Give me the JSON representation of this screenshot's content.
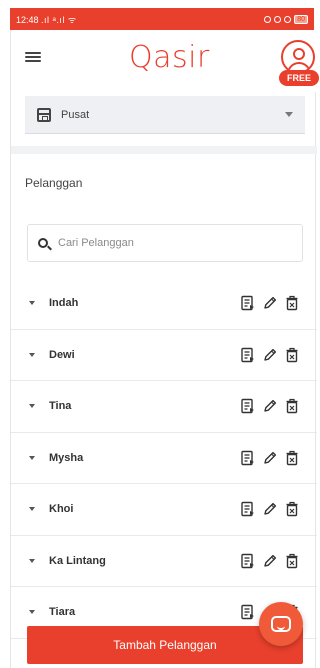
{
  "status_bar": {
    "time": "12:48",
    "signal": ".ıl ᵃ.ıl ᯤ",
    "battery": "80"
  },
  "header": {
    "logo": "Qasir",
    "badge": "FREE"
  },
  "outlet": {
    "selected": "Pusat"
  },
  "section": {
    "title": "Pelanggan"
  },
  "search": {
    "placeholder": "Cari Pelanggan"
  },
  "customers": [
    {
      "name": "Indah"
    },
    {
      "name": "Dewi"
    },
    {
      "name": "Tina"
    },
    {
      "name": "Mysha"
    },
    {
      "name": "Khoi"
    },
    {
      "name": "Ka Lintang"
    },
    {
      "name": "Tiara"
    }
  ],
  "actions": {
    "add_label": "Tambah Pelanggan"
  },
  "icons": {
    "row_actions": [
      "detail-icon",
      "edit-icon",
      "delete-icon"
    ],
    "menu": "hamburger-icon",
    "chat": "chat-icon"
  },
  "colors": {
    "brand": "#e8402c",
    "chat": "#f05a38"
  }
}
